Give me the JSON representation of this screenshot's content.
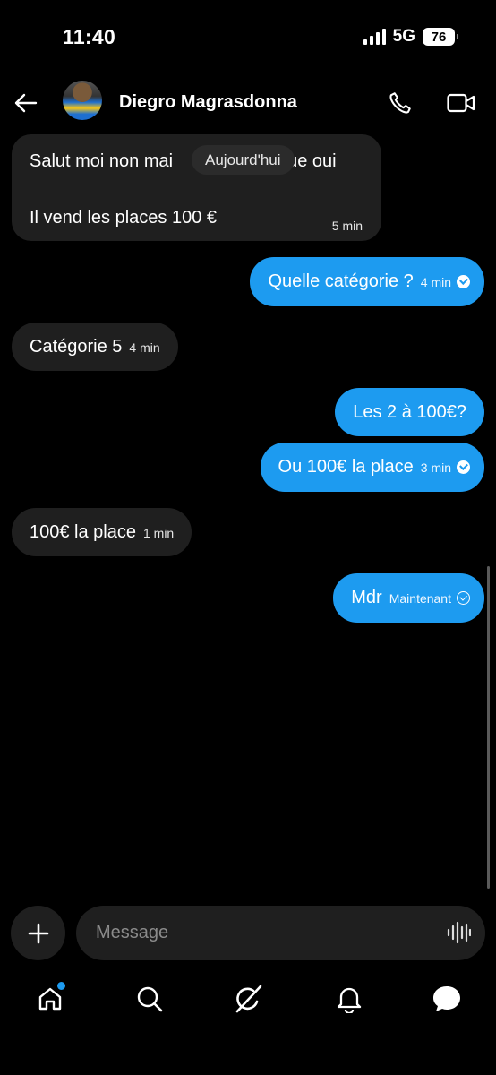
{
  "status_bar": {
    "time": "11:40",
    "network": "5G",
    "battery": "76"
  },
  "header": {
    "contact_name": "Diegro Magrasdonna"
  },
  "date_separator": "Aujourd'hui",
  "messages": [
    {
      "direction": "in",
      "lines": [
        "Salut moi non mai",
        "ue oui",
        "Il vend les places 100 €"
      ],
      "time": "5 min"
    },
    {
      "direction": "out",
      "text": "Quelle catégorie ?",
      "time": "4 min",
      "status": "read"
    },
    {
      "direction": "in",
      "text": "Catégorie 5",
      "time": "4 min"
    },
    {
      "direction": "out",
      "text": "Les 2 à 100€?"
    },
    {
      "direction": "out",
      "text": "Ou 100€ la place",
      "time": "3 min",
      "status": "read"
    },
    {
      "direction": "in",
      "text": "100€ la place",
      "time": "1 min"
    },
    {
      "direction": "out",
      "text": "Mdr",
      "time": "Maintenant",
      "status": "sent"
    }
  ],
  "composer": {
    "placeholder": "Message"
  },
  "bottom_nav": {
    "items": [
      "home-icon",
      "search-icon",
      "grok-icon",
      "notifications-icon",
      "messages-icon"
    ],
    "active": "messages-icon",
    "home_has_dot": true
  },
  "colors": {
    "accent": "#1d9bf0",
    "incoming_bubble": "#1f1f1f",
    "background": "#000000"
  }
}
